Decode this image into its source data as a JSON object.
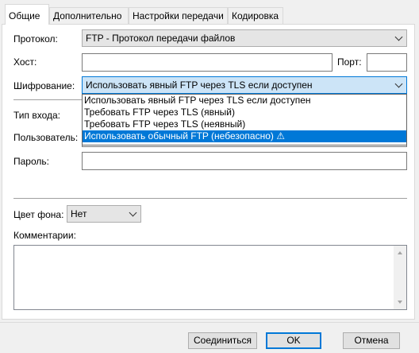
{
  "tabs": [
    {
      "label": "Общие"
    },
    {
      "label": "Дополнительно"
    },
    {
      "label": "Настройки передачи"
    },
    {
      "label": "Кодировка"
    }
  ],
  "form": {
    "protocol_label": "Протокол:",
    "protocol_value": "FTP - Протокол передачи файлов",
    "host_label": "Хост:",
    "host_value": "",
    "port_label": "Порт:",
    "port_value": "",
    "encryption_label": "Шифрование:",
    "encryption_value": "Использовать явный FTP через TLS если доступен",
    "login_type_label": "Тип входа:",
    "user_label": "Пользователь:",
    "password_label": "Пароль:",
    "bg_color_label": "Цвет фона:",
    "bg_color_value": "Нет",
    "comments_label": "Комментарии:"
  },
  "encryption_options": [
    {
      "label": "Использовать явный FTP через TLS если доступен"
    },
    {
      "label": "Требовать FTP через TLS (явный)"
    },
    {
      "label": "Требовать FTP через TLS (неявный)"
    },
    {
      "label": "Использовать обычный FTP (небезопасно) ⚠"
    }
  ],
  "buttons": {
    "connect": "Соединиться",
    "ok": "OK",
    "cancel": "Отмена"
  },
  "colors": {
    "accent": "#0078d7",
    "selection": "#0078d7",
    "focus_bg": "#cce4f7"
  }
}
